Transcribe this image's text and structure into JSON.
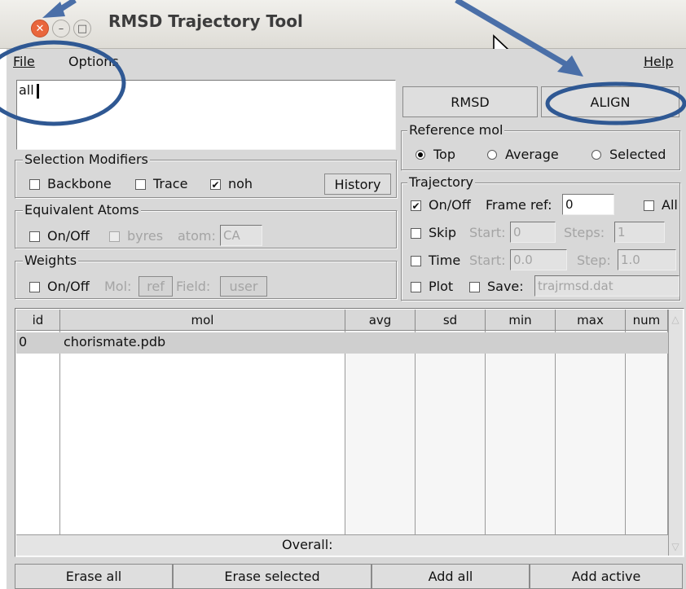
{
  "window": {
    "title": "RMSD Trajectory Tool"
  },
  "menu": {
    "file": "File",
    "options": "Options",
    "help": "Help"
  },
  "selection": {
    "text": "all"
  },
  "buttons": {
    "rmsd": "RMSD",
    "align": "ALIGN",
    "history": "History",
    "erase_all": "Erase all",
    "erase_selected": "Erase selected",
    "add_all": "Add all",
    "add_active": "Add active"
  },
  "selection_modifiers": {
    "title": "Selection Modifiers",
    "backbone": "Backbone",
    "trace": "Trace",
    "noh": "noh",
    "noh_checked": true
  },
  "equivalent_atoms": {
    "title": "Equivalent Atoms",
    "onoff": "On/Off",
    "byres": "byres",
    "atom_label": "atom:",
    "atom_value": "CA"
  },
  "weights": {
    "title": "Weights",
    "onoff": "On/Off",
    "mol_label": "Mol:",
    "mol_value": "ref",
    "field_label": "Field:",
    "field_value": "user"
  },
  "reference_mol": {
    "title": "Reference mol",
    "top": "Top",
    "average": "Average",
    "selected": "Selected",
    "selected_option": "Top"
  },
  "trajectory": {
    "title": "Trajectory",
    "onoff": "On/Off",
    "frame_ref_label": "Frame ref:",
    "frame_ref_value": "0",
    "all": "All",
    "skip": "Skip",
    "start_label": "Start:",
    "skip_start": "0",
    "steps_label": "Steps:",
    "steps_value": "1",
    "time": "Time",
    "time_start": "0.0",
    "step_label": "Step:",
    "step_value": "1.0",
    "plot": "Plot",
    "save_label": "Save:",
    "save_value": "trajrmsd.dat"
  },
  "table": {
    "headers": [
      "id",
      "mol",
      "avg",
      "sd",
      "min",
      "max",
      "num"
    ],
    "rows": [
      {
        "id": "0",
        "mol": "chorismate.pdb"
      }
    ],
    "overall": "Overall:"
  },
  "colors": {
    "annotation": "#4a6fa8",
    "close_button": "#e9663c"
  }
}
